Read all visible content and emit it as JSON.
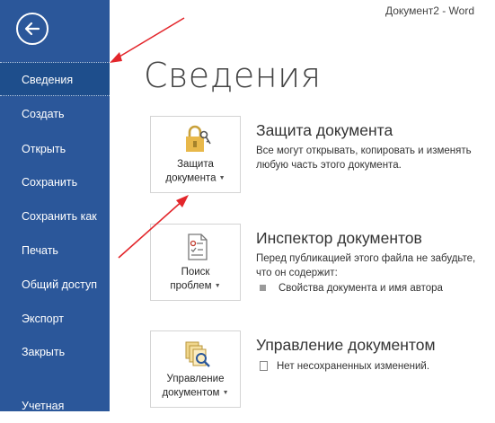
{
  "window": {
    "title": "Документ2  -  Word"
  },
  "sidebar": {
    "items": [
      {
        "label": "Сведения",
        "active": true
      },
      {
        "label": "Создать"
      },
      {
        "label": "Открыть"
      },
      {
        "label": "Сохранить"
      },
      {
        "label": "Сохранить как"
      },
      {
        "label": "Печать"
      },
      {
        "label": "Общий доступ"
      },
      {
        "label": "Экспорт"
      },
      {
        "label": "Закрыть"
      },
      {
        "label": "Учетная"
      }
    ]
  },
  "main": {
    "title": "Сведения",
    "sections": [
      {
        "button_line1": "Защита",
        "button_line2": "документа",
        "heading": "Защита документа",
        "text1": "Все могут открывать, копировать и изменять",
        "text2": "любую часть этого документа."
      },
      {
        "button_line1": "Поиск",
        "button_line2": "проблем",
        "heading": "Инспектор документов",
        "text1": "Перед публикацией этого файла не забудьте,",
        "text2": "что он содержит:",
        "bullet": "Свойства документа и имя автора"
      },
      {
        "button_line1": "Управление",
        "button_line2": "документом",
        "heading": "Управление документом",
        "bullet": "Нет несохраненных изменений."
      }
    ]
  },
  "colors": {
    "sidebar": "#2b579a",
    "active": "#1e4e8c",
    "annotation_arrow": "#e3262b"
  },
  "icons": [
    "back-arrow-icon",
    "lock-key-icon",
    "inspect-document-icon",
    "manage-document-icon"
  ]
}
